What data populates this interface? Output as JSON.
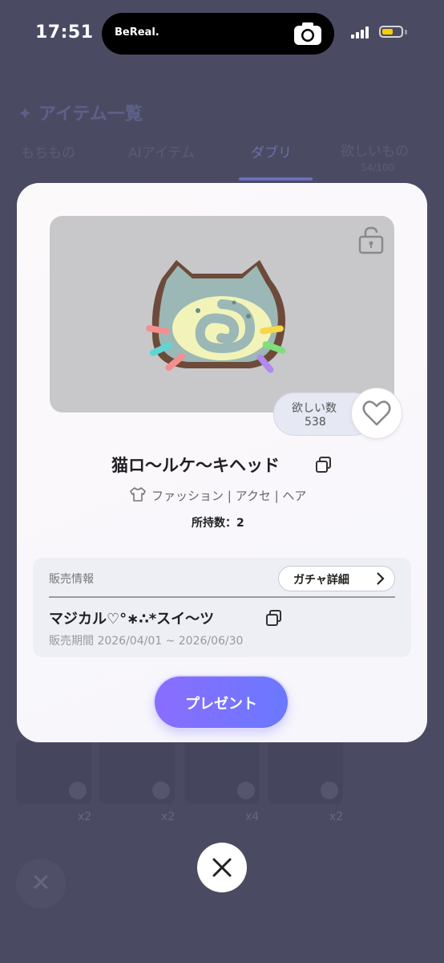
{
  "status_bar": {
    "time": "17:51",
    "island_label": "BeReal.",
    "battery_color": "#f7cd07"
  },
  "background": {
    "title": "✦ アイテム一覧",
    "tabs": [
      "もちもの",
      "AIアイテム",
      "ダブリ",
      "欲しいもの"
    ],
    "wishlist_count": "54/100",
    "item_counts": [
      "x2",
      "x2",
      "x4",
      "x2"
    ]
  },
  "modal": {
    "lock_icon": "unlock-icon",
    "wish": {
      "label": "欲しい数",
      "count": "538",
      "icon": "heart-icon"
    },
    "item_name": "猫ロ〜ルケ〜キヘッド",
    "category": "ファッション | アクセ | ヘア",
    "owned": "所持数：2",
    "sale": {
      "label": "販売情報",
      "gacha_button": "ガチャ詳細",
      "gacha_name": "マジカル♡°∗∴*スイ〜ツ",
      "period": "販売期間 2026/04/01 ~ 2026/06/30"
    },
    "present_button": "プレゼント",
    "accent_color": "#7b6ffe"
  }
}
